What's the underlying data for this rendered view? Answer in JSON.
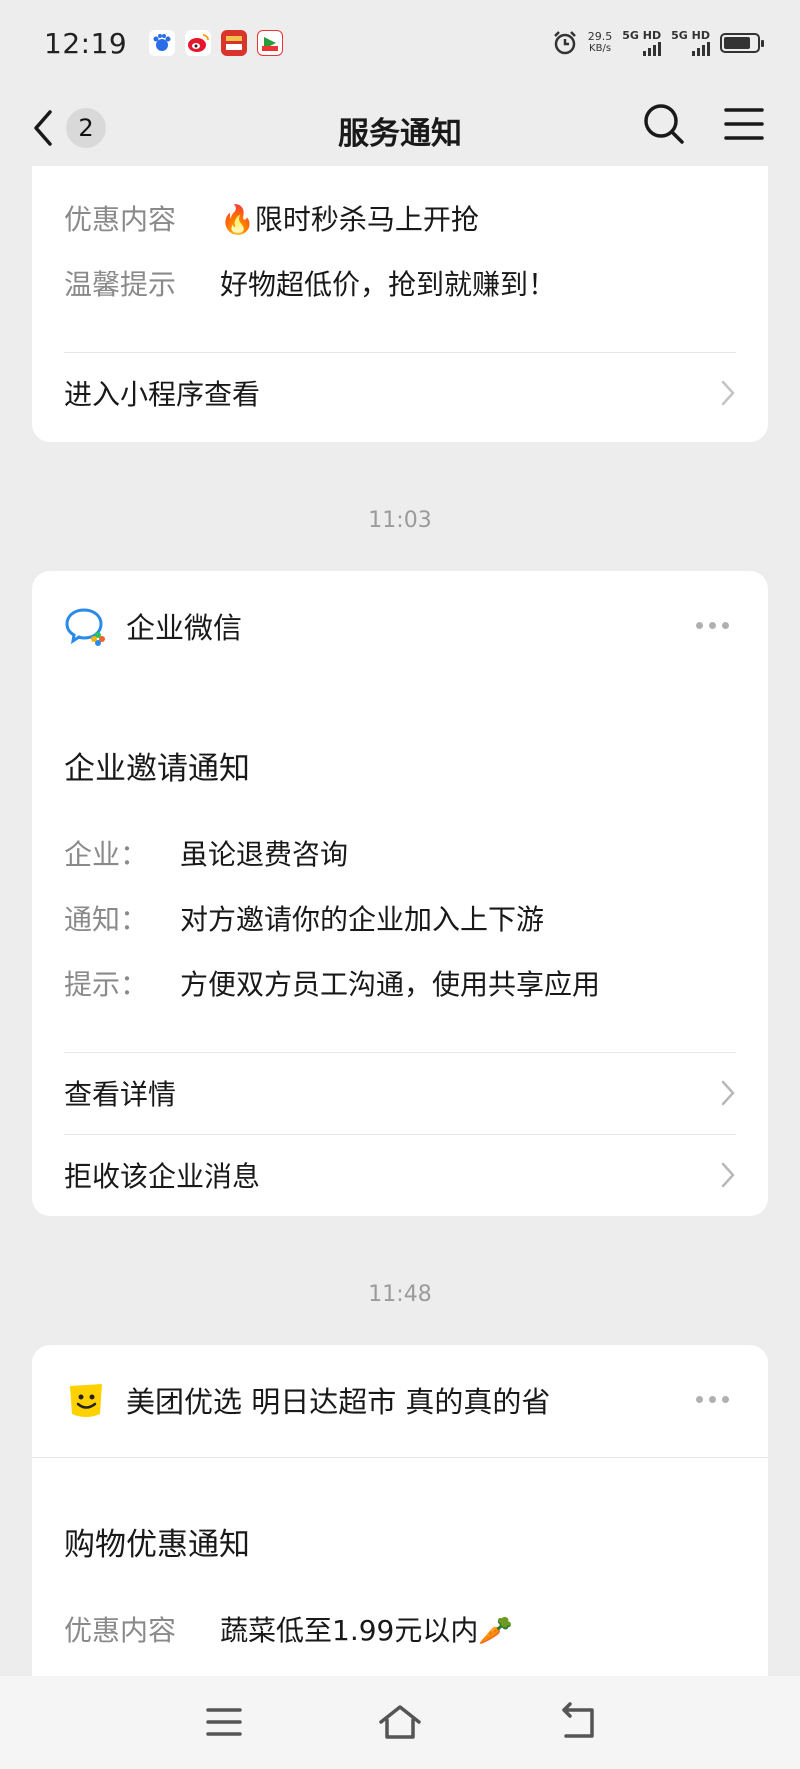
{
  "status_bar": {
    "time": "12:19",
    "network_speed": "29.5",
    "network_unit": "KB/s",
    "sim1": "5G HD",
    "sim2": "5G HD",
    "icons": [
      "baidu-icon",
      "weibo-icon",
      "news-app-icon",
      "video-app-icon",
      "alarm-icon",
      "signal-icon",
      "battery-icon"
    ]
  },
  "nav": {
    "unread_count": "2",
    "title": "服务通知"
  },
  "cards": [
    {
      "rows": [
        {
          "label": "优惠内容",
          "value": "🔥限时秒杀马上开抢"
        },
        {
          "label": "温馨提示",
          "value": "好物超低价，抢到就赚到！"
        }
      ],
      "link": "进入小程序查看"
    },
    {
      "time": "11:03",
      "sender": "企业微信",
      "title": "企业邀请通知",
      "rows": [
        {
          "label": "企业：",
          "value": "虽论退费咨询"
        },
        {
          "label": "通知：",
          "value": "对方邀请你的企业加入上下游"
        },
        {
          "label": "提示：",
          "value": "方便双方员工沟通，使用共享应用"
        }
      ],
      "links": [
        "查看详情",
        "拒收该企业消息"
      ]
    },
    {
      "time": "11:48",
      "sender": "美团优选 明日达超市 真的真的省",
      "title": "购物优惠通知",
      "rows": [
        {
          "label": "优惠内容",
          "value": "蔬菜低至1.99元以内🥕"
        }
      ]
    }
  ],
  "colors": {
    "background": "#ededed",
    "card": "#ffffff",
    "label": "#8a8a8a",
    "text": "#191919"
  }
}
